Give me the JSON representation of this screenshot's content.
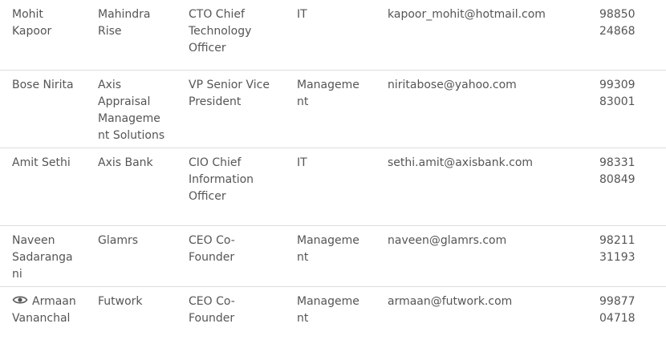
{
  "rows": [
    {
      "name": "Mohit Kapoor",
      "company": "Mahindra Rise",
      "title": "CTO Chief Technology Officer",
      "department": "IT",
      "email": "kapoor_mohit@hotmail.com",
      "phone": "98850 24868"
    },
    {
      "name": "Bose Nirita",
      "company": "Axis Appraisal Management Solutions",
      "title": "VP Senior Vice President",
      "department": "Management",
      "email": "niritabose@yahoo.com",
      "phone": "99309 83001"
    },
    {
      "name": "Amit Sethi",
      "company": "Axis Bank",
      "title": "CIO Chief Information Officer",
      "department": "IT",
      "email": "sethi.amit@axisbank.com",
      "phone": "98331 80849"
    },
    {
      "name": "Naveen Sadarangani",
      "company": "Glamrs",
      "title": "CEO Co-Founder",
      "department": "Management",
      "email": "naveen@glamrs.com",
      "phone": "98211 31193"
    },
    {
      "name": "Armaan Vananchal",
      "company": "Futwork",
      "title": "CEO Co-Founder",
      "department": "Management",
      "email": "armaan@futwork.com",
      "phone": "99877 04718",
      "icon": "eye-icon"
    }
  ]
}
